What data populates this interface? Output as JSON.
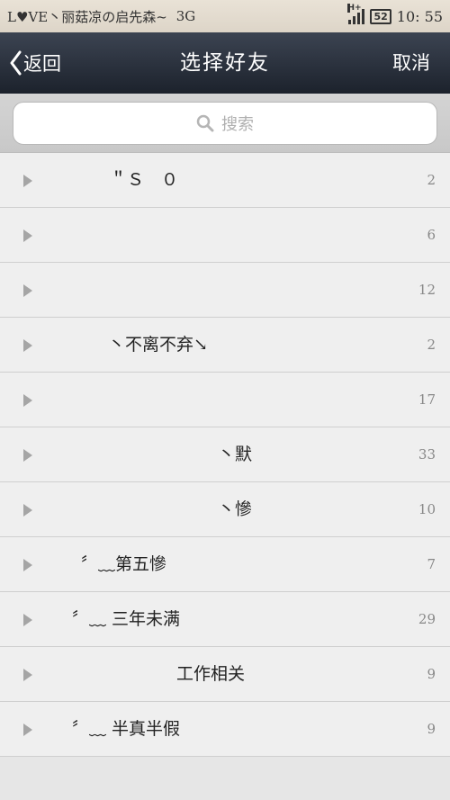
{
  "status_bar": {
    "carrier_text": "L♥VE丶丽菇凉の启先森~",
    "network": "3G",
    "signal_type": "H+",
    "battery": "52",
    "time": "10: 55"
  },
  "header": {
    "back_label": "返回",
    "title": "选择好友",
    "cancel_label": "取消"
  },
  "search": {
    "placeholder": "搜索"
  },
  "groups": [
    {
      "name": "＂Ｓ　０",
      "count": "2"
    },
    {
      "name": "",
      "count": "6"
    },
    {
      "name": "",
      "count": "12"
    },
    {
      "name": "丶不离不弃↘",
      "count": "2"
    },
    {
      "name": "",
      "count": "17"
    },
    {
      "name": "丶默",
      "count": "33"
    },
    {
      "name": "丶慘",
      "count": "10"
    },
    {
      "name": "〞﹏第五慘",
      "count": "7"
    },
    {
      "name": "〞﹏ 三年未满",
      "count": "29"
    },
    {
      "name": "工作相关",
      "count": "9"
    },
    {
      "name": "〞﹏ 半真半假",
      "count": "9"
    }
  ],
  "colors": {
    "header_bg": "#2a313c",
    "list_bg": "#efefef",
    "status_bg": "#e4ddd1"
  }
}
